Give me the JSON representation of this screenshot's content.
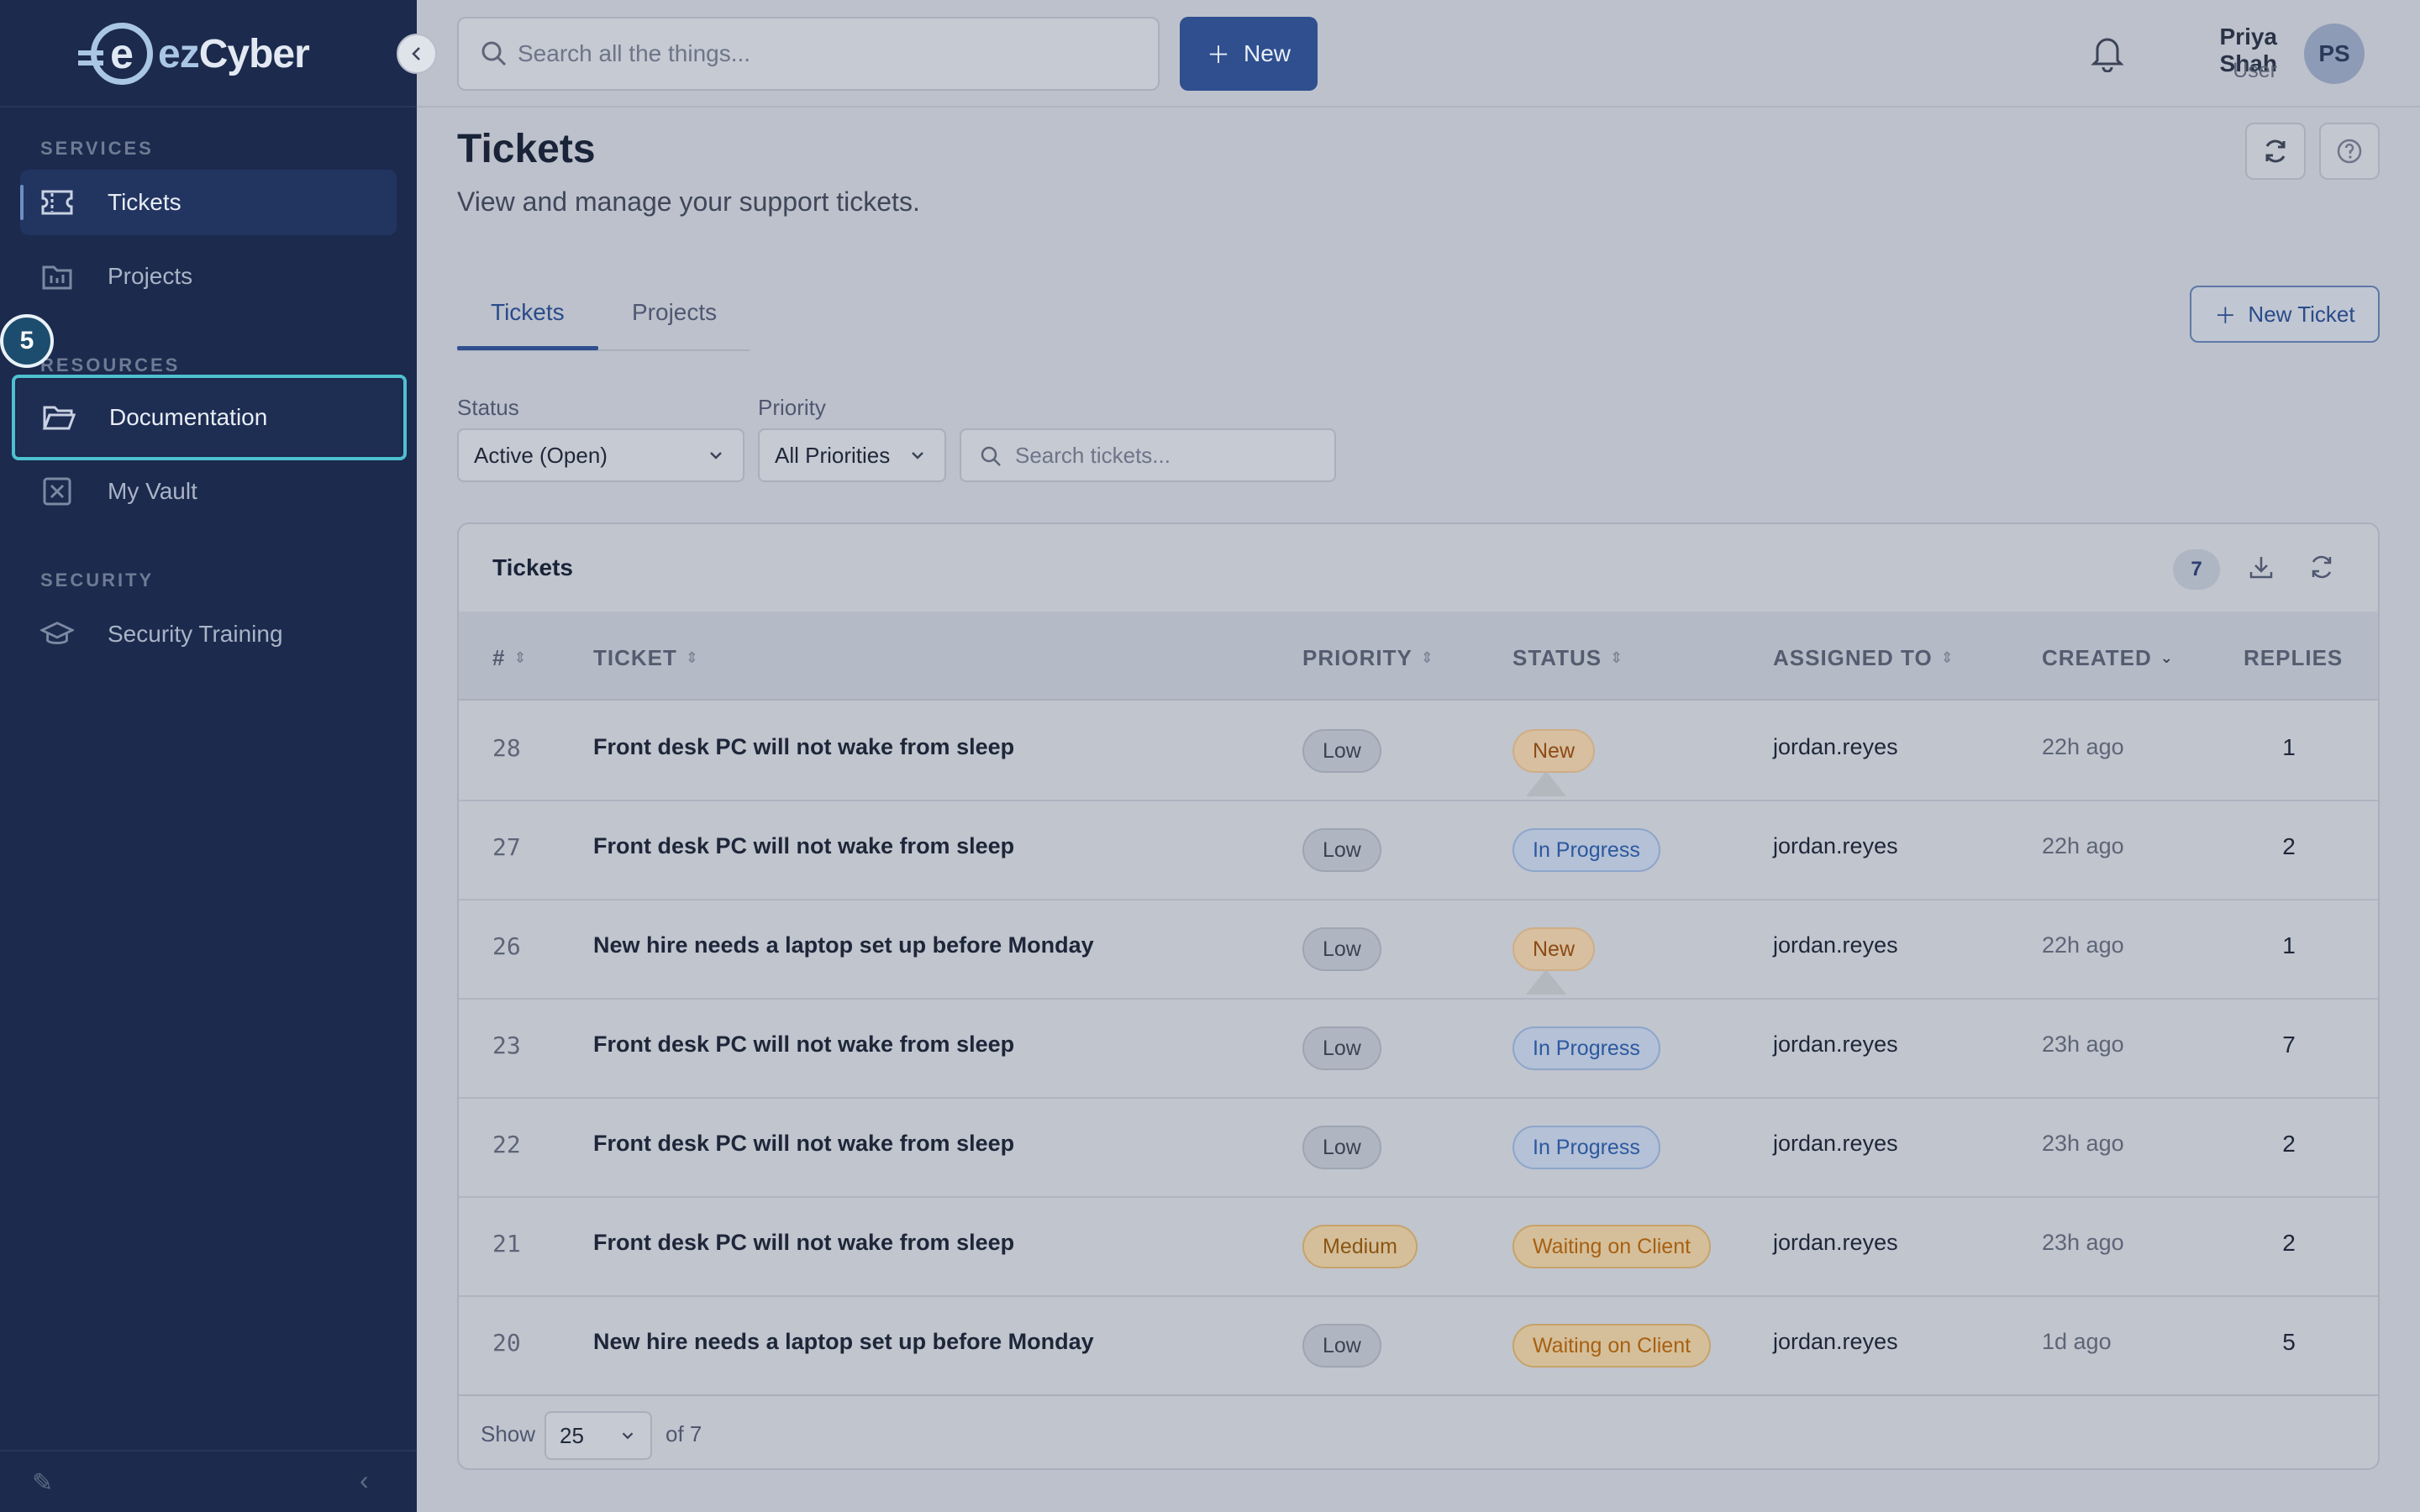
{
  "brand": {
    "part1": "ez",
    "part2": "Cyber"
  },
  "sidebar": {
    "sections": [
      {
        "label": "SERVICES"
      },
      {
        "label": "RESOURCES"
      },
      {
        "label": "SECURITY"
      }
    ],
    "items": [
      {
        "label": "Tickets",
        "icon": "ticket-icon",
        "active": true
      },
      {
        "label": "Projects",
        "icon": "projects-icon"
      },
      {
        "label": "Documentation",
        "icon": "folder-icon",
        "focused": true
      },
      {
        "label": "My Vault",
        "icon": "vault-icon"
      },
      {
        "label": "Security Training",
        "icon": "graduation-cap-icon"
      }
    ],
    "step_badge": "5"
  },
  "topbar": {
    "search_placeholder": "Search all the things...",
    "new_label": "New",
    "user_name": "Priya Shah",
    "user_role": "User",
    "avatar_initials": "PS"
  },
  "page": {
    "title": "Tickets",
    "subtitle": "View and manage your support tickets.",
    "tabs": [
      {
        "label": "Tickets",
        "active": true
      },
      {
        "label": "Projects"
      }
    ],
    "new_ticket_label": "New Ticket"
  },
  "filters": {
    "status_label": "Status",
    "status_value": "Active (Open)",
    "priority_label": "Priority",
    "priority_value": "All Priorities",
    "search_placeholder": "Search tickets..."
  },
  "table": {
    "title": "Tickets",
    "count": "7",
    "columns": {
      "num": "#",
      "ticket": "TICKET",
      "priority": "PRIORITY",
      "status": "STATUS",
      "assigned": "ASSIGNED TO",
      "created": "CREATED",
      "replies": "REPLIES"
    },
    "rows": [
      {
        "num": "28",
        "ticket": "Front desk PC will not wake from sleep",
        "priority": "Low",
        "status": "New",
        "assigned": "jordan.reyes",
        "created": "22h ago",
        "replies": "1"
      },
      {
        "num": "27",
        "ticket": "Front desk PC will not wake from sleep",
        "priority": "Low",
        "status": "In Progress",
        "assigned": "jordan.reyes",
        "created": "22h ago",
        "replies": "2"
      },
      {
        "num": "26",
        "ticket": "New hire needs a laptop set up before Monday",
        "priority": "Low",
        "status": "New",
        "assigned": "jordan.reyes",
        "created": "22h ago",
        "replies": "1"
      },
      {
        "num": "23",
        "ticket": "Front desk PC will not wake from sleep",
        "priority": "Low",
        "status": "In Progress",
        "assigned": "jordan.reyes",
        "created": "23h ago",
        "replies": "7"
      },
      {
        "num": "22",
        "ticket": "Front desk PC will not wake from sleep",
        "priority": "Low",
        "status": "In Progress",
        "assigned": "jordan.reyes",
        "created": "23h ago",
        "replies": "2"
      },
      {
        "num": "21",
        "ticket": "Front desk PC will not wake from sleep",
        "priority": "Medium",
        "status": "Waiting on Client",
        "assigned": "jordan.reyes",
        "created": "23h ago",
        "replies": "2"
      },
      {
        "num": "20",
        "ticket": "New hire needs a laptop set up before Monday",
        "priority": "Low",
        "status": "Waiting on Client",
        "assigned": "jordan.reyes",
        "created": "1d ago",
        "replies": "5"
      }
    ],
    "footer": {
      "show_label": "Show",
      "page_size": "25",
      "of_label": "of 7"
    }
  },
  "colors": {
    "sidebar_bg": "#1b2a4d",
    "accent": "#2f4f8f",
    "focus_ring": "#4fc0d0"
  }
}
